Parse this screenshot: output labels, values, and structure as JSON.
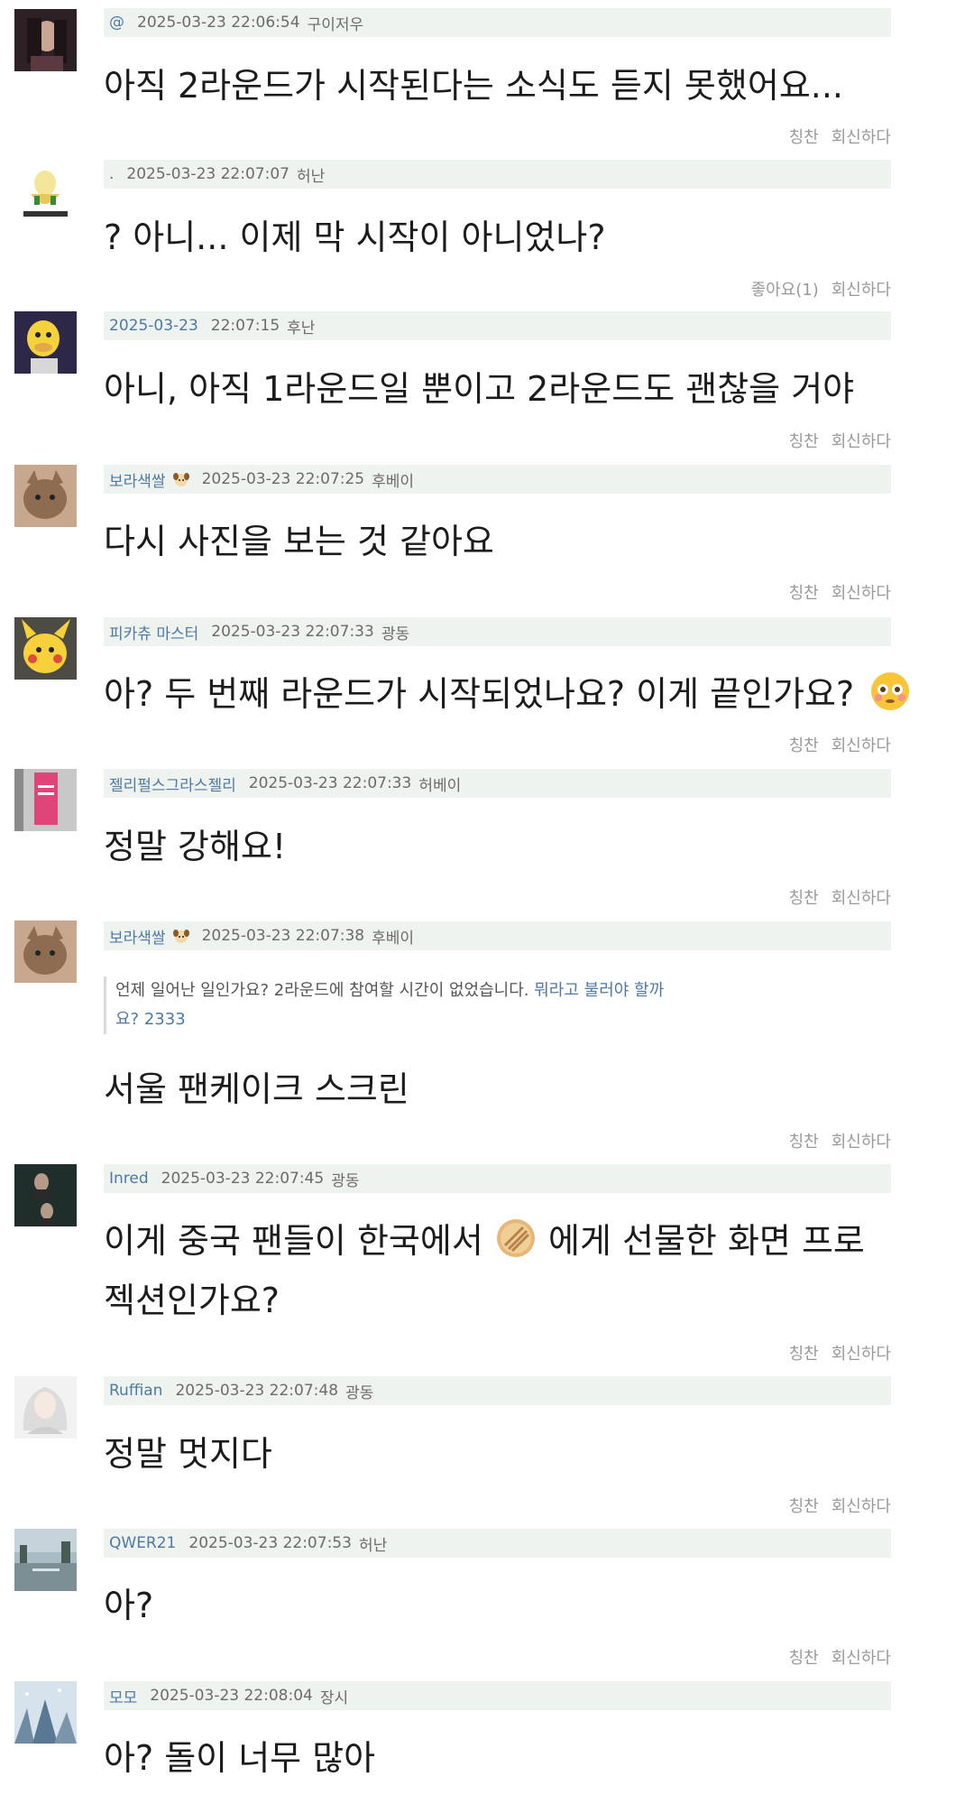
{
  "comments": [
    {
      "user": "@",
      "timestamp": "2025-03-23 22:06:54",
      "location": "구이저우",
      "text": "아직 2라운드가 시작된다는 소식도 듣지 못했어요...",
      "actions": [
        "칭찬",
        "회신하다"
      ]
    },
    {
      "user": ".",
      "timestamp": "2025-03-23 22:07:07",
      "location": "허난",
      "text": "? 아니... 이제 막 시작이 아니었나?",
      "actions": [
        "좋아요(1)",
        "회신하다"
      ]
    },
    {
      "user": "2025-03-23",
      "timestamp": "22:07:15",
      "location": "후난",
      "text": "아니, 아직 1라운드일 뿐이고 2라운드도 괜찮을 거야",
      "actions": [
        "칭찬",
        "회신하다"
      ]
    },
    {
      "user": "보라색쌀",
      "timestamp": "2025-03-23 22:07:25",
      "location": "후베이",
      "text": "다시 사진을 보는 것 같아요",
      "actions": [
        "칭찬",
        "회신하다"
      ]
    },
    {
      "user": "피카츄 마스터",
      "timestamp": "2025-03-23 22:07:33",
      "location": "광동",
      "text": "아? 두 번째 라운드가 시작되었나요? 이게 끝인가요?",
      "actions": [
        "칭찬",
        "회신하다"
      ]
    },
    {
      "user": "젤리펄스그라스젤리",
      "timestamp": "2025-03-23 22:07:33",
      "location": "허베이",
      "text": "정말 강해요!",
      "actions": [
        "칭찬",
        "회신하다"
      ]
    },
    {
      "user": "보라색쌀",
      "timestamp": "2025-03-23 22:07:38",
      "location": "후베이",
      "quote_text": "언제 일어난 일인가요? 2라운드에 참여할 시간이 없었습니다.",
      "quote_link": "뭐라고 불러야 할까요? 2333",
      "text": "서울 팬케이크 스크린",
      "actions": [
        "칭찬",
        "회신하다"
      ]
    },
    {
      "user": "Inred",
      "timestamp": "2025-03-23 22:07:45",
      "location": "광동",
      "text_before": "이게 중국 팬들이 한국에서",
      "text_after": "에게 선물한 화면 프로젝션인가요?",
      "actions": [
        "칭찬",
        "회신하다"
      ]
    },
    {
      "user": "Ruffian",
      "timestamp": "2025-03-23 22:07:48",
      "location": "광동",
      "text": "정말 멋지다",
      "actions": [
        "칭찬",
        "회신하다"
      ]
    },
    {
      "user": "QWER21",
      "timestamp": "2025-03-23 22:07:53",
      "location": "허난",
      "text": "아?",
      "actions": [
        "칭찬",
        "회신하다"
      ]
    },
    {
      "user": "모모",
      "timestamp": "2025-03-23 22:08:04",
      "location": "장시",
      "text": "아? 돌이 너무 많아",
      "actions": []
    }
  ]
}
